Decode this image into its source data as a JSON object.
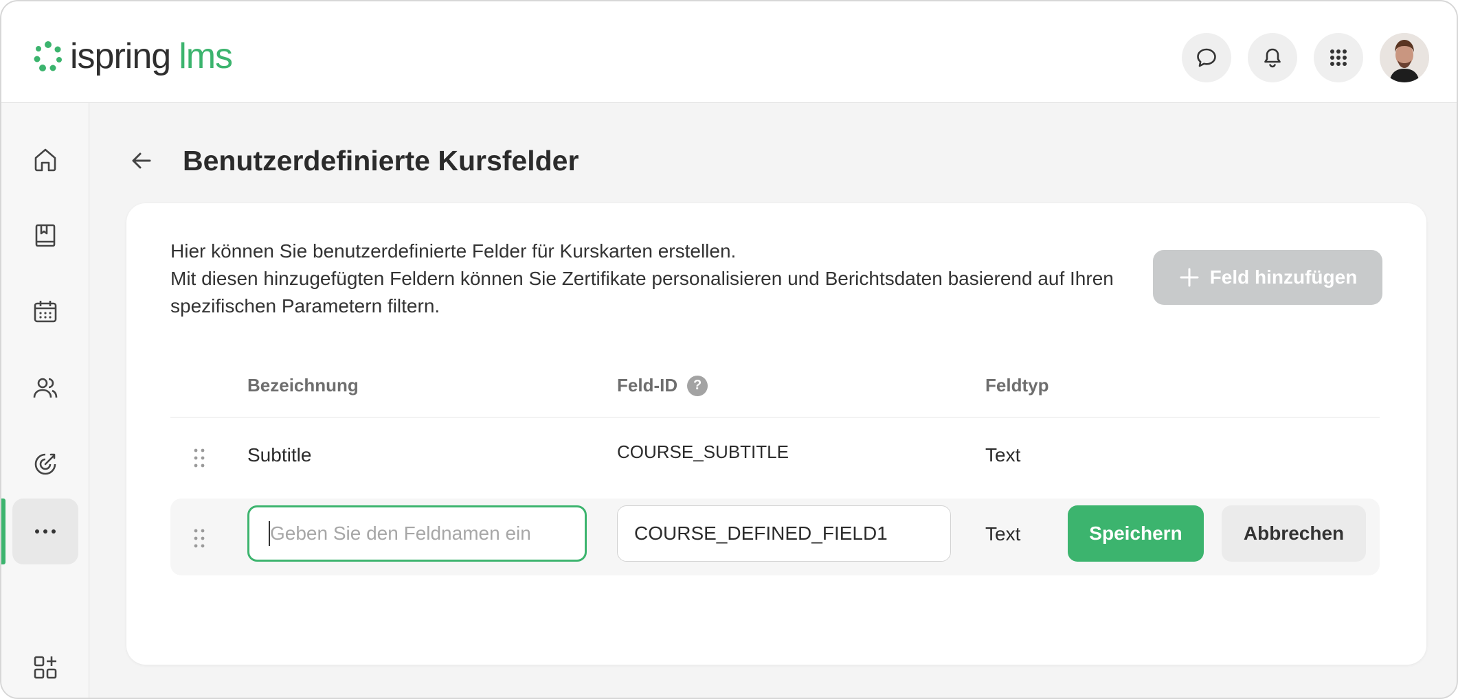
{
  "header": {
    "logo_brand": "ispring",
    "logo_product": "lms",
    "actions": [
      "chat-icon",
      "bell-icon",
      "apps-grid-icon"
    ]
  },
  "sidebar": {
    "items": [
      "home-icon",
      "book-icon",
      "calendar-icon",
      "users-icon",
      "target-icon",
      "more-icon",
      "add-widget-icon"
    ],
    "active_index": 5
  },
  "page": {
    "title": "Benutzerdefinierte Kursfelder",
    "intro_line1": "Hier können Sie benutzerdefinierte Felder für Kurskarten erstellen.",
    "intro_line2": "Mit diesen hinzugefügten Feldern können Sie Zertifikate personalisieren und Berichtsdaten basierend auf Ihren spezifischen Parametern filtern.",
    "add_button": "Feld hinzufügen"
  },
  "table": {
    "columns": {
      "label": "Bezeichnung",
      "field_id": "Feld-ID",
      "field_type": "Feldtyp"
    },
    "help_icon": "?",
    "rows": [
      {
        "label": "Subtitle",
        "field_id": "COURSE_SUBTITLE",
        "field_type": "Text"
      }
    ],
    "edit_row": {
      "name_placeholder": "Geben Sie den Feldnamen ein",
      "field_id_value": "COURSE_DEFINED_FIELD1",
      "field_type": "Text",
      "save_label": "Speichern",
      "cancel_label": "Abbrechen"
    }
  },
  "colors": {
    "accent": "#3cb46e",
    "disabled_button": "#c8cacb"
  }
}
